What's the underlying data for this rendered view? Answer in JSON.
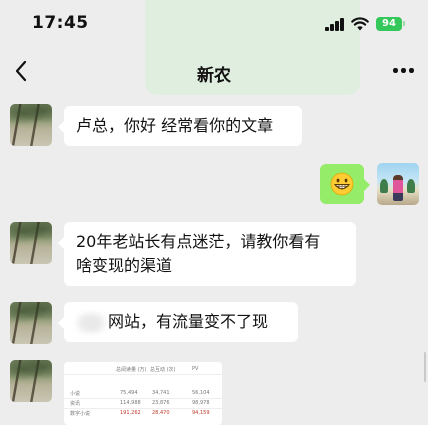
{
  "status_bar": {
    "time": "17:45",
    "battery": "94",
    "battery_color": "#34c759"
  },
  "header": {
    "title": "新农",
    "back_icon": "chevron-left-icon",
    "more_icon": "more-dots-icon"
  },
  "colors": {
    "background": "#ededed",
    "incoming_bubble": "#ffffff",
    "outgoing_bubble": "#95ec69"
  },
  "messages": [
    {
      "side": "incoming",
      "text": "卢总，你好 经常看你的文章"
    },
    {
      "side": "outgoing",
      "type": "emoji",
      "icon": "grinning-face-icon"
    },
    {
      "side": "incoming",
      "lines": [
        "20年老站长有点迷茫，请教你看有",
        "啥变现的渠道"
      ]
    },
    {
      "side": "incoming",
      "text": "网站，有流量变不了现"
    },
    {
      "side": "incoming",
      "type": "image",
      "table": {
        "headers": [
          "",
          "总阅读量 (万)",
          "总互动 (次)",
          "PV"
        ],
        "rows": [
          [
            "小说",
            "75,494",
            "34,741",
            "56,104"
          ],
          [
            "资讯",
            "114,988",
            "23,876",
            "98,978"
          ],
          [
            "数字小说",
            "191,262",
            "28,470",
            "94,159"
          ]
        ]
      }
    }
  ]
}
